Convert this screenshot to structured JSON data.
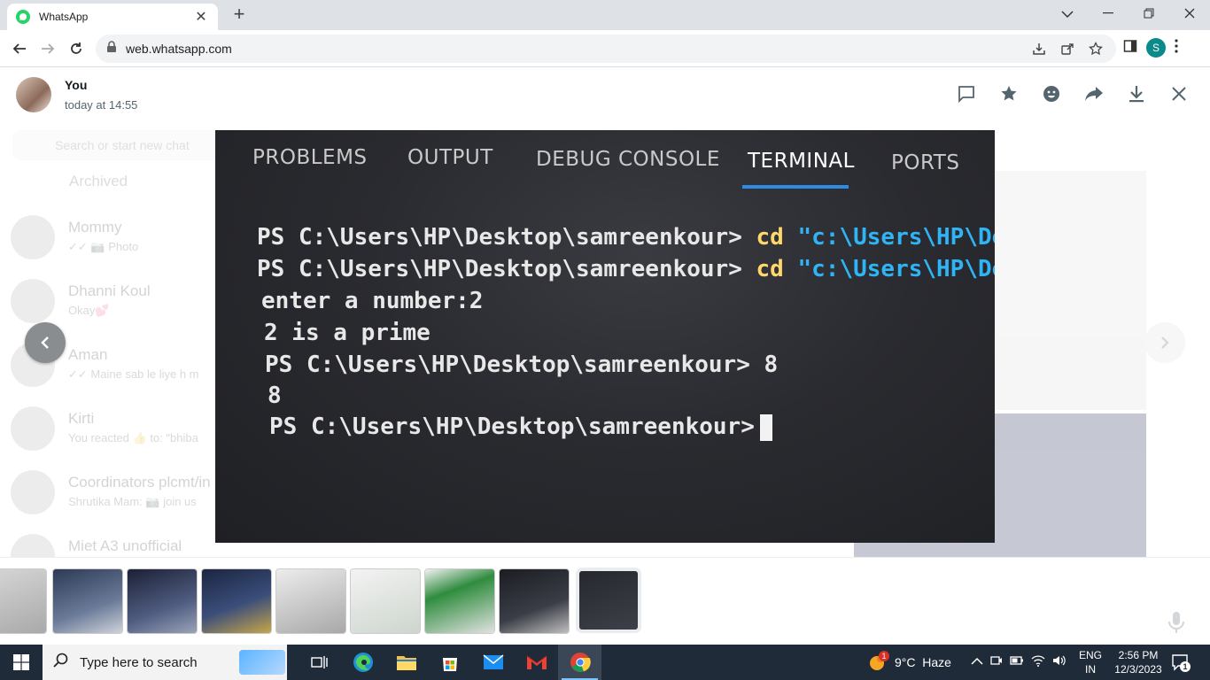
{
  "browser": {
    "tab_title": "WhatsApp",
    "url": "web.whatsapp.com",
    "profile_initial": "S"
  },
  "viewer": {
    "sender": "You",
    "timestamp": "today at 14:55"
  },
  "background": {
    "search_placeholder": "Search or start new chat",
    "archived_label": "Archived",
    "chats": [
      {
        "name": "Mommy",
        "preview": "✓✓ 📷 Photo"
      },
      {
        "name": "Dhanni Koul",
        "preview": "Okay💕"
      },
      {
        "name": "Aman",
        "preview": "✓✓ Maine sab le liye h m"
      },
      {
        "name": "Kirti",
        "preview": "You reacted 👍 to: \"bhiba"
      },
      {
        "name": "Coordinators plcmt/in",
        "preview": "Shrutika Mam: 📷 join us"
      },
      {
        "name": "Miet A3 unofficial",
        "preview": ""
      }
    ]
  },
  "photo": {
    "tabs": [
      "PROBLEMS",
      "OUTPUT",
      "DEBUG CONSOLE",
      "TERMINAL",
      "PORTS"
    ],
    "active_tab": "TERMINAL",
    "lines": [
      {
        "prompt": "PS C:\\Users\\HP\\Desktop\\samreenkour>",
        "cmd": "cd",
        "arg": "\"c:\\Users\\HP\\Des"
      },
      {
        "prompt": "PS C:\\Users\\HP\\Desktop\\samreenkour>",
        "cmd": "cd",
        "arg": "\"c:\\Users\\HP\\Desk"
      },
      {
        "text": "enter a number:2"
      },
      {
        "text": "2 is a prime"
      },
      {
        "text": "PS C:\\Users\\HP\\Desktop\\samreenkour> 8"
      },
      {
        "text": "8"
      },
      {
        "text": "PS C:\\Users\\HP\\Desktop\\samreenkour>"
      }
    ]
  },
  "taskbar": {
    "search_placeholder": "Type here to search",
    "weather": "9°C  Haze",
    "weather_badge": "1",
    "lang_top": "ENG",
    "lang_bottom": "IN",
    "time": "2:56 PM",
    "date": "12/3/2023",
    "notification_count": "1"
  },
  "colors": {
    "whatsapp_green": "#25d366",
    "terminal_tab_underline": "#2e8be0",
    "terminal_cmd": "#ffd86b",
    "terminal_string": "#2fb4f5",
    "taskbar_bg": "#1f2b38"
  }
}
